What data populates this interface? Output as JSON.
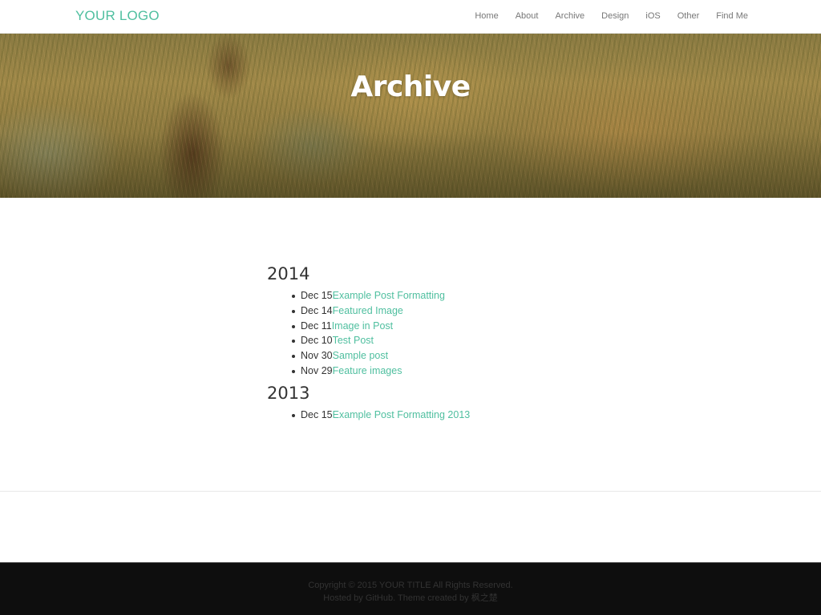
{
  "header": {
    "logo": "YOUR LOGO",
    "nav": [
      {
        "label": "Home"
      },
      {
        "label": "About"
      },
      {
        "label": "Archive"
      },
      {
        "label": "Design"
      },
      {
        "label": "iOS"
      },
      {
        "label": "Other"
      },
      {
        "label": "Find Me"
      }
    ]
  },
  "hero": {
    "title": "Archive"
  },
  "archive": [
    {
      "year": "2014",
      "posts": [
        {
          "date": "Dec 15",
          "title": "Example Post Formatting"
        },
        {
          "date": "Dec 14",
          "title": "Featured Image"
        },
        {
          "date": "Dec 11",
          "title": "Image in Post"
        },
        {
          "date": "Dec 10",
          "title": "Test Post"
        },
        {
          "date": "Nov 30",
          "title": "Sample post"
        },
        {
          "date": "Nov 29",
          "title": "Feature images"
        }
      ]
    },
    {
      "year": "2013",
      "posts": [
        {
          "date": "Dec 15",
          "title": "Example Post Formatting 2013"
        }
      ]
    }
  ],
  "footer": {
    "copyright": "Copyright © 2015 YOUR TITLE All Rights Reserved.",
    "credits": "Hosted by GitHub. Theme created by 枫之楚"
  },
  "colors": {
    "accent": "#4fbf9f",
    "footer_bg": "#0e0e0e"
  }
}
